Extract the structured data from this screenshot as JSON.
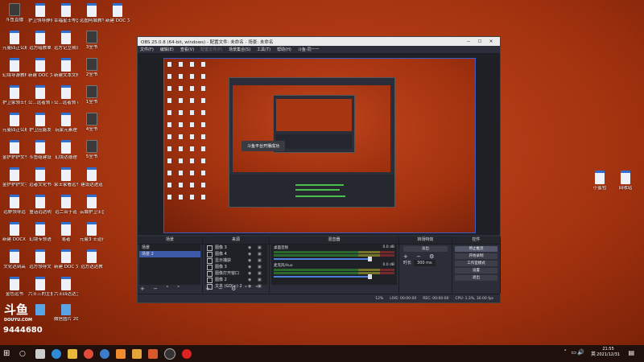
{
  "desktop": {
    "left_icons": [
      {
        "label": "斗鱼直播",
        "type": "exe",
        "col": 0,
        "row": 0
      },
      {
        "label": "护卫领导静候",
        "type": "doc",
        "col": 1,
        "row": 0
      },
      {
        "label": "幸福星士等国之刃卷士黄",
        "type": "doc",
        "col": 2,
        "row": 0
      },
      {
        "label": "远图阿城教学作带钢差",
        "type": "doc",
        "col": 3,
        "row": 0
      },
      {
        "label": "新建 DOC 文档(2)",
        "type": "doc",
        "col": 4,
        "row": 0
      },
      {
        "label": "元曼四正公刷",
        "type": "doc",
        "col": 0,
        "row": 1
      },
      {
        "label": "远方暗教单",
        "type": "doc",
        "col": 1,
        "row": 1
      },
      {
        "label": "远方记立期范",
        "type": "doc",
        "col": 2,
        "row": 1
      },
      {
        "label": "3全书",
        "type": "exe",
        "col": 3,
        "row": 1
      },
      {
        "label": "幻境导游教样普射斯",
        "type": "doc",
        "col": 0,
        "row": 2
      },
      {
        "label": "新建 DOC 文档",
        "type": "doc",
        "col": 1,
        "row": 2
      },
      {
        "label": "新建文本文档",
        "type": "doc",
        "col": 2,
        "row": 2
      },
      {
        "label": "2全书",
        "type": "exe",
        "col": 3,
        "row": 2
      },
      {
        "label": "护卫家领士位领士大姓启复现",
        "type": "doc",
        "col": 0,
        "row": 3
      },
      {
        "label": "公...远者领 (1)",
        "type": "doc",
        "col": 1,
        "row": 3
      },
      {
        "label": "公...远者领 (1)",
        "type": "doc",
        "col": 2,
        "row": 3
      },
      {
        "label": "1全书",
        "type": "exe",
        "col": 3,
        "row": 3
      },
      {
        "label": "元曼四正公刷 2",
        "type": "doc",
        "col": 0,
        "row": 4
      },
      {
        "label": "护卫应能发",
        "type": "doc",
        "col": 1,
        "row": 4
      },
      {
        "label": "玩家元素理",
        "type": "doc",
        "col": 2,
        "row": 4
      },
      {
        "label": "4全书",
        "type": "exe",
        "col": 3,
        "row": 4
      },
      {
        "label": "金护护护文书",
        "type": "doc",
        "col": 0,
        "row": 5
      },
      {
        "label": "斗鱼组建设",
        "type": "doc",
        "col": 1,
        "row": 5
      },
      {
        "label": "幻境达德理",
        "type": "doc",
        "col": 2,
        "row": 5
      },
      {
        "label": "5全书",
        "type": "exe",
        "col": 3,
        "row": 5
      },
      {
        "label": "金护护护文字",
        "type": "doc",
        "col": 0,
        "row": 6
      },
      {
        "label": "远者文化书",
        "type": "doc",
        "col": 1,
        "row": 6
      },
      {
        "label": "家士家看远书文",
        "type": "doc",
        "col": 2,
        "row": 6
      },
      {
        "label": "建设达进道",
        "type": "doc",
        "col": 3,
        "row": 6
      },
      {
        "label": "远野领导远",
        "type": "doc",
        "col": 0,
        "row": 7
      },
      {
        "label": "童话远达明",
        "type": "doc",
        "col": 1,
        "row": 7
      },
      {
        "label": "远二合于道",
        "type": "doc",
        "col": 2,
        "row": 7
      },
      {
        "label": "云城护卫士国外的文化",
        "type": "doc",
        "col": 3,
        "row": 7
      },
      {
        "label": "新建 DOCX 文档",
        "type": "doc",
        "col": 0,
        "row": 8
      },
      {
        "label": "幻境专领语",
        "type": "doc",
        "col": 1,
        "row": 8
      },
      {
        "label": "笔者",
        "type": "doc",
        "col": 2,
        "row": 8
      },
      {
        "label": "元曼3 士道行中...",
        "type": "doc",
        "col": 3,
        "row": 8
      },
      {
        "label": "文化达到高",
        "type": "doc",
        "col": 0,
        "row": 9
      },
      {
        "label": "远方领导文",
        "type": "doc",
        "col": 1,
        "row": 9
      },
      {
        "label": "新建 DOC 文档",
        "type": "doc",
        "col": 2,
        "row": 9
      },
      {
        "label": "远方达达教",
        "type": "doc",
        "col": 3,
        "row": 9
      },
      {
        "label": "金色远书",
        "type": "doc",
        "col": 0,
        "row": 10
      },
      {
        "label": "六士三的主要",
        "type": "doc",
        "col": 1,
        "row": 10
      },
      {
        "label": "六士四达达主要",
        "type": "doc",
        "col": 2,
        "row": 10
      },
      {
        "label": "",
        "type": "img",
        "col": 1,
        "row": 11
      },
      {
        "label": "微信图片 2021...",
        "type": "img",
        "col": 2,
        "row": 11
      }
    ],
    "right_icons": [
      {
        "label": "小蜜包",
        "type": "doc"
      },
      {
        "label": "回收站",
        "type": "doc"
      }
    ],
    "watermark": "9444680",
    "logo_big": "斗鱼",
    "logo_small": "DOUYU.COM"
  },
  "obs": {
    "title": "OBS 25.0.8 (64-bit, windows) - 配置文件: 未命名 - 场景: 未命名",
    "menu": [
      "文件(F)",
      "编辑(E)",
      "查看(V)",
      "配置文件(P)",
      "场景集合(S)",
      "工具(T)",
      "帮助(H)",
      "斗鱼-同一一"
    ],
    "dim_menu_index": 3,
    "toast": "斗鱼平台开播成功",
    "docks": {
      "scenes": {
        "header": "场景",
        "items": [
          "场景",
          "场景 2"
        ],
        "selected": 1
      },
      "sources": {
        "header": "来源",
        "items": [
          {
            "name": "图像 3"
          },
          {
            "name": "图像 4"
          },
          {
            "name": "显示捕获"
          },
          {
            "name": "图像 3"
          },
          {
            "name": "图像打开窗口"
          },
          {
            "name": "图像 2"
          },
          {
            "name": "文本 (GDI+) 2"
          }
        ]
      },
      "mixer": {
        "header": "混音器",
        "tracks": [
          {
            "name": "桌面音频",
            "db": "0.0 dB"
          },
          {
            "name": "麦克风/Aux",
            "db": "0.0 dB"
          }
        ]
      },
      "transitions": {
        "header": "转场特效",
        "type": "淡出",
        "duration_label": "时长",
        "duration": "300 ms"
      },
      "controls": {
        "header": "控件",
        "buttons": [
          "停止推流",
          "开始录制",
          "工作室模式",
          "设置",
          "退出"
        ],
        "active": 0
      }
    },
    "status": {
      "live": "LIVE: 00:00:00",
      "rec": "REC: 00:00:00",
      "cpu": "CPU: 1.3%, 30.00 fps",
      "drop": "12%"
    }
  },
  "taskbar": {
    "time": "21:55",
    "date": "2021/12/31",
    "lang": "英"
  }
}
